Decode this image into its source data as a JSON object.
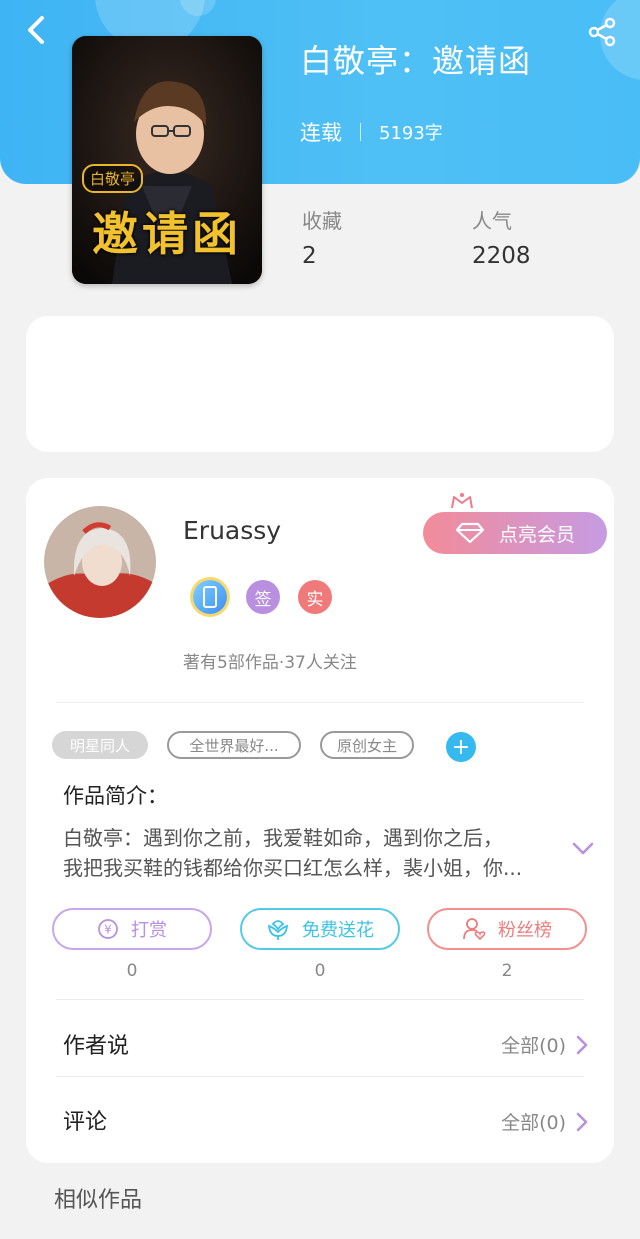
{
  "colors": {
    "header_blue": "#3fb4f4",
    "purple": "#b98fe0",
    "cyan": "#3cc4e4",
    "red": "#ef7c7c",
    "chevron": "#b98fe0"
  },
  "book": {
    "title": "白敬亭：邀请函",
    "status": "连载",
    "word_count": "5193字",
    "cover_text": {
      "small": "白敬亭",
      "big": "邀请函"
    }
  },
  "stats": [
    {
      "label": "收藏",
      "value": "2"
    },
    {
      "label": "人气",
      "value": "2208"
    }
  ],
  "author": {
    "name": "Eruassy",
    "vip_label": "点亮会员",
    "badges": [
      {
        "icon": "phone-badge-icon",
        "text": ""
      },
      {
        "icon": "sign-badge-icon",
        "text": "签"
      },
      {
        "icon": "real-badge-icon",
        "text": "实"
      }
    ],
    "works_info": "著有5部作品·37人关注"
  },
  "tags": [
    "明星同人",
    "全世界最好...",
    "原创女主"
  ],
  "intro": {
    "heading": "作品简介：",
    "line1": "白敬亭：遇到你之前，我爱鞋如命，遇到你之后，",
    "line2": "我把我买鞋的钱都给你买口红怎么样，裴小姐，你..."
  },
  "actions": [
    {
      "icon": "yen-icon",
      "label": "打赏",
      "count": "0"
    },
    {
      "icon": "flower-icon",
      "label": "免费送花",
      "count": "0"
    },
    {
      "icon": "fan-icon",
      "label": "粉丝榜",
      "count": "2"
    }
  ],
  "rows": [
    {
      "label": "作者说",
      "right": "全部(0)"
    },
    {
      "label": "评论",
      "right": "全部(0)"
    }
  ],
  "similar_heading": "相似作品"
}
